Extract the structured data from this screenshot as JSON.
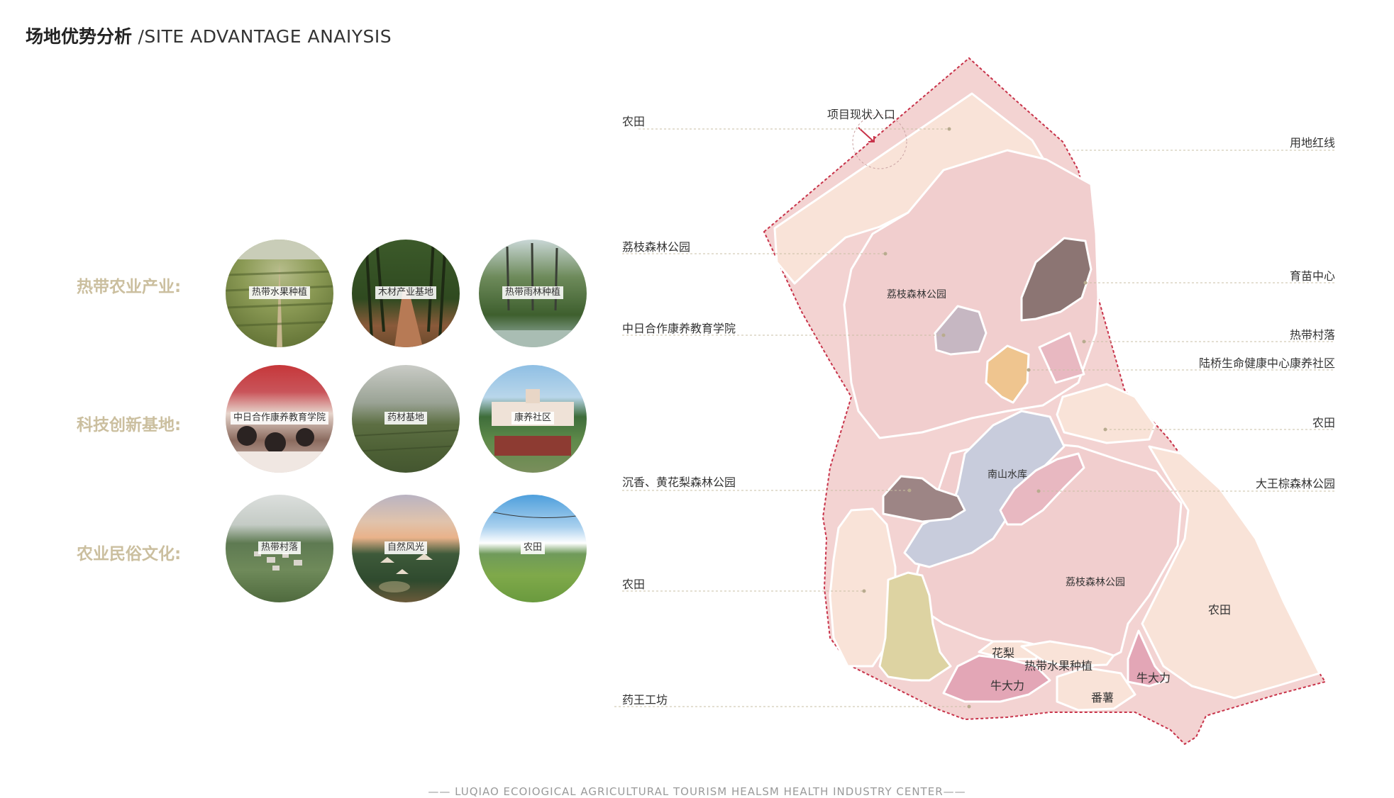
{
  "header": {
    "title_zh": "场地优势分析",
    "title_sep": " /",
    "title_en": "SITE ADVANTAGE ANAIYSIS"
  },
  "categories": [
    {
      "label": "热带农业产业:",
      "items": [
        {
          "caption": "热带水果种植",
          "photo": "fruit-plantation"
        },
        {
          "caption": "木材产业基地",
          "photo": "timber-road"
        },
        {
          "caption": "热带雨林种植",
          "photo": "palm-forest"
        }
      ]
    },
    {
      "label": "科技创新基地:",
      "items": [
        {
          "caption": "中日合作康养教育学院",
          "photo": "meeting-room"
        },
        {
          "caption": "药材基地",
          "photo": "herb-field"
        },
        {
          "caption": "康养社区",
          "photo": "wellness-building"
        }
      ]
    },
    {
      "label": "农业民俗文化:",
      "items": [
        {
          "caption": "热带村落",
          "photo": "village-aerial"
        },
        {
          "caption": "自然风光",
          "photo": "sunset-camp"
        },
        {
          "caption": "农田",
          "photo": "green-farmland"
        }
      ]
    }
  ],
  "map": {
    "callouts_left": [
      "农田",
      "荔枝森林公园",
      "中日合作康养教育学院",
      "沉香、黄花梨森林公园",
      "农田",
      "药王工坊"
    ],
    "callouts_right": [
      "用地红线",
      "育苗中心",
      "热带村落",
      "陆桥生命健康中心康养社区",
      "农田",
      "大王棕森林公园"
    ],
    "entrance_label": "项目现状入口",
    "zone_labels": [
      "荔枝森林公园",
      "南山水库",
      "荔枝森林公园",
      "农田",
      "花梨",
      "热带水果种植",
      "牛大力",
      "牛大力",
      "番薯"
    ],
    "colors": {
      "boundary_fill": "#f3d3d2",
      "boundary_line": "#c8334a",
      "farmland": "#f9e3d8",
      "forest_park": "#f1cece",
      "nursery": "#8c7573",
      "reservoir": "#c8ccdc",
      "village": "#e8b8c1",
      "school": "#c6b7c2",
      "community": "#efc58f",
      "herb": "#ddd3a2",
      "niudali": "#e3a6b6",
      "agarwood": "#9d8585"
    }
  },
  "footer": {
    "text": "—— LUQIAO  ECOIOGICAL  AGRICULTURAL  TOURISM  HEALSM  HEALTH  INDUSTRY  CENTER——"
  }
}
